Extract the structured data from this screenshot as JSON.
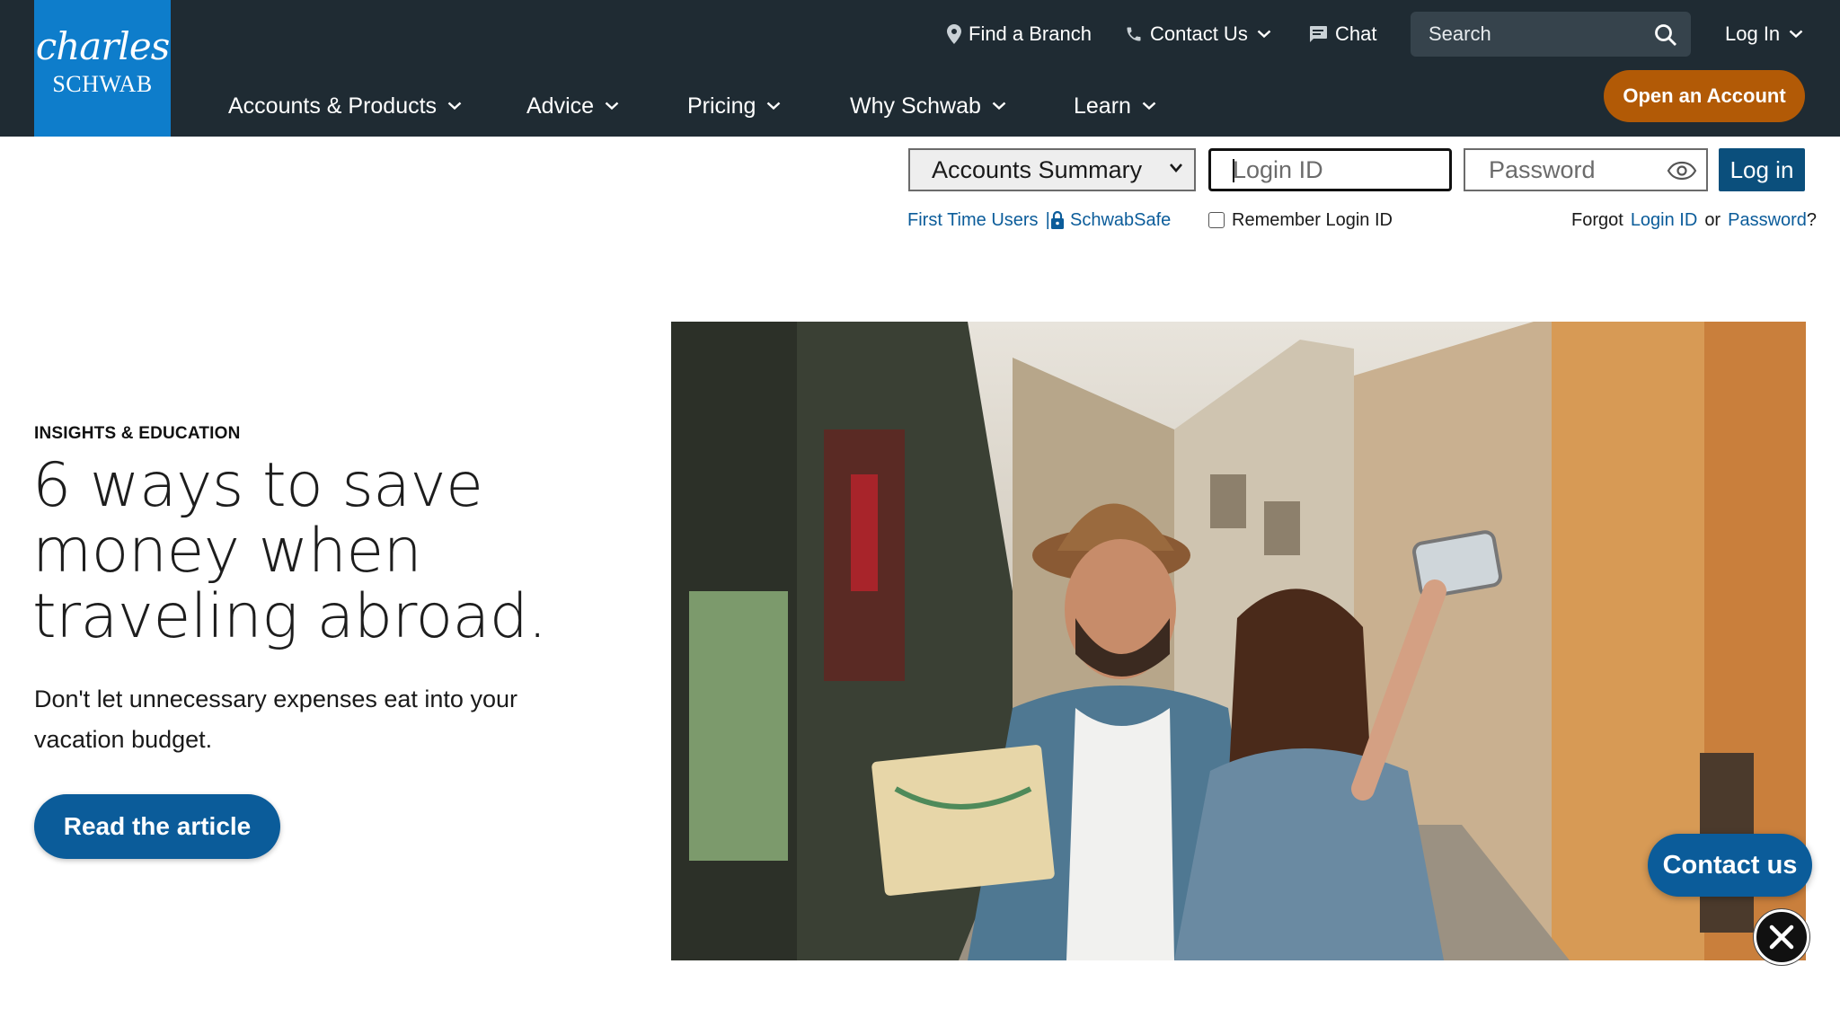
{
  "brand": {
    "logo_script": "charles",
    "logo_caps": "SCHWAB",
    "logo_color": "#0e7dcb",
    "header_bg": "#1f2b33"
  },
  "utility_nav": {
    "find_branch": "Find a Branch",
    "contact_us": "Contact Us",
    "chat": "Chat",
    "search_placeholder": "Search",
    "log_in": "Log In"
  },
  "main_nav": {
    "items": [
      {
        "label": "Accounts & Products"
      },
      {
        "label": "Advice"
      },
      {
        "label": "Pricing"
      },
      {
        "label": "Why Schwab"
      },
      {
        "label": "Learn"
      }
    ],
    "open_account": "Open an Account",
    "open_account_color": "#b25a06"
  },
  "login_bar": {
    "account_select": "Accounts Summary",
    "login_id_placeholder": "Login ID",
    "password_placeholder": "Password",
    "login_button": "Log in",
    "first_time_users": "First Time Users",
    "separator": "|",
    "schwab_safe": "SchwabSafe",
    "remember_login": "Remember Login ID",
    "remember_checked": false,
    "forgot_prefix": "Forgot",
    "forgot_login_id": "Login ID",
    "forgot_or": "or",
    "forgot_password": "Password",
    "forgot_suffix": "?"
  },
  "hero": {
    "eyebrow": "INSIGHTS & EDUCATION",
    "headline": "6 ways to save money when traveling abroad.",
    "subhead": "Don't let unnecessary expenses eat into your vacation budget.",
    "cta": "Read the article",
    "image_icon": "travelers-photo"
  },
  "floating": {
    "contact_us": "Contact us",
    "close_icon": "close-icon"
  },
  "colors": {
    "link": "#0b5c9a",
    "primary_button": "#0b4f7c"
  }
}
